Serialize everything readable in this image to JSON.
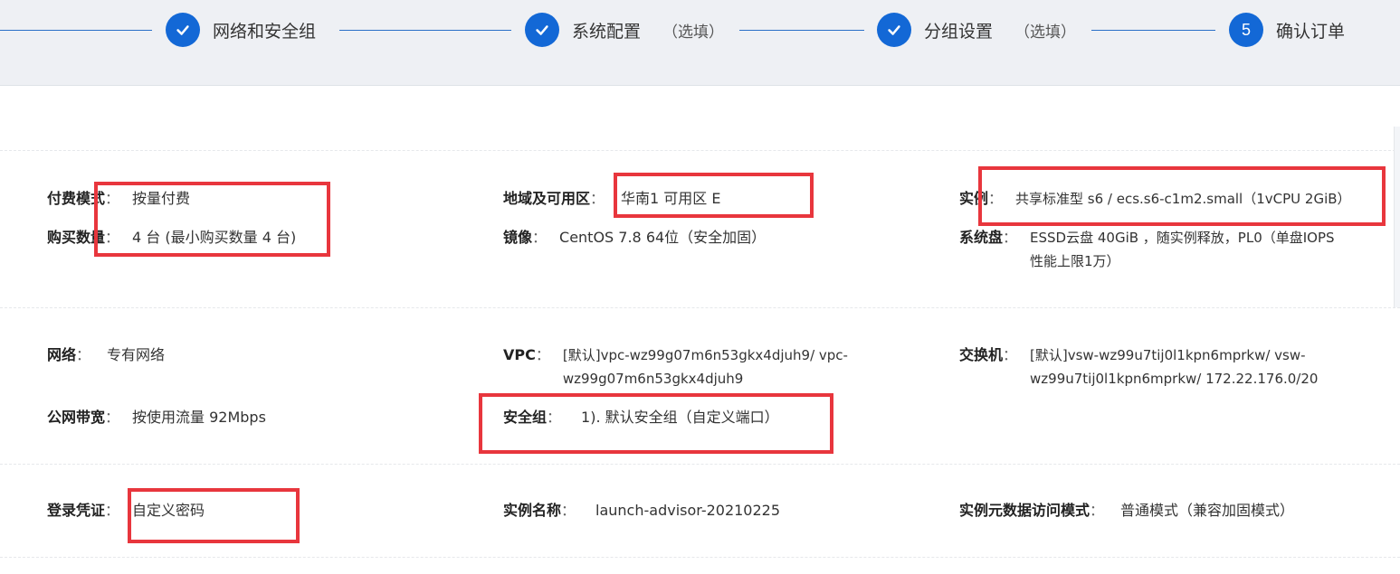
{
  "steps": [
    {
      "label": "网络和安全组",
      "optional": "",
      "state": "done",
      "icon": "check-icon"
    },
    {
      "label": "系统配置",
      "optional": "（选填）",
      "state": "done",
      "icon": "check-icon"
    },
    {
      "label": "分组设置",
      "optional": "（选填）",
      "state": "done",
      "icon": "check-icon"
    },
    {
      "label": "确认订单",
      "optional": "",
      "state": "current",
      "number": "5"
    }
  ],
  "colors": {
    "accent": "#1368d6",
    "highlight": "#e8363d",
    "header_bg": "#eef0f4"
  },
  "sections": {
    "billing": {
      "pay_mode": {
        "label": "付费模式",
        "value": "按量付费"
      },
      "quantity": {
        "label": "购买数量",
        "value": "4 台 (最小购买数量 4 台)"
      },
      "region": {
        "label": "地域及可用区",
        "value": "华南1 可用区 E"
      },
      "image": {
        "label": "镜像",
        "value": "CentOS 7.8 64位（安全加固）"
      },
      "instance": {
        "label": "实例",
        "value": "共享标准型 s6 / ecs.s6-c1m2.small（1vCPU 2GiB）"
      },
      "system_disk": {
        "label": "系统盘",
        "value_line1": "ESSD云盘 40GiB ，随实例释放，PL0（单盘IOPS",
        "value_line2": "性能上限1万）"
      }
    },
    "network": {
      "network": {
        "label": "网络",
        "value": "专有网络"
      },
      "bandwidth": {
        "label": "公网带宽",
        "value": "按使用流量 92Mbps"
      },
      "vpc": {
        "label": "VPC",
        "value_line1": "[默认]vpc-wz99g07m6n53gkx4djuh9/ vpc-",
        "value_line2": "wz99g07m6n53gkx4djuh9"
      },
      "security_group": {
        "label": "安全组",
        "value": "1). 默认安全组（自定义端口）"
      },
      "vswitch": {
        "label": "交换机",
        "value_line1": "[默认]vsw-wz99u7tij0l1kpn6mprkw/ vsw-",
        "value_line2": "wz99u7tij0l1kpn6mprkw/ 172.22.176.0/20"
      }
    },
    "system": {
      "credential": {
        "label": "登录凭证",
        "value": "自定义密码"
      },
      "instance_name": {
        "label": "实例名称",
        "value": "launch-advisor-20210225"
      },
      "metadata_mode": {
        "label": "实例元数据访问模式",
        "value": "普通模式（兼容加固模式）"
      }
    }
  },
  "colon": "："
}
